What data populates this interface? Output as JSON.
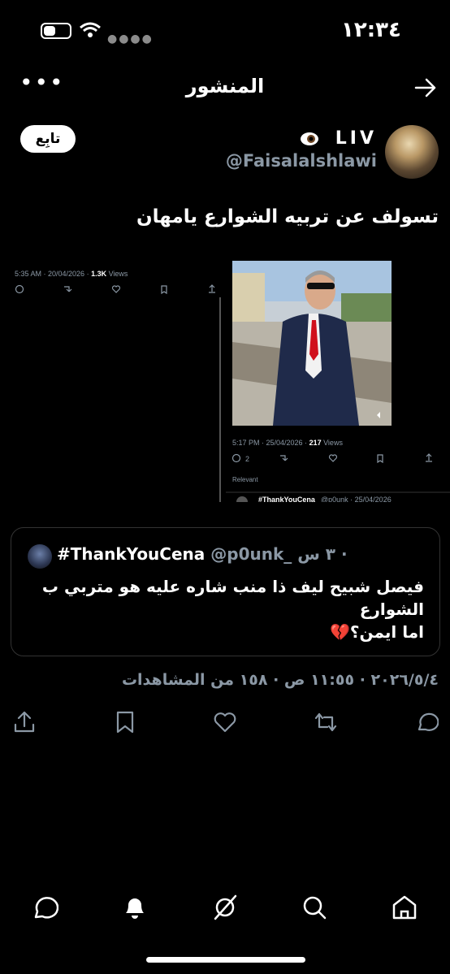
{
  "status_bar": {
    "time": "١٢:٣٤"
  },
  "header": {
    "title": "المنشور"
  },
  "author": {
    "display_name": "LIV",
    "handle": "@Faisalalshlawi",
    "follow_label": "تابِع"
  },
  "tweet": {
    "text": "تسولف عن تربيه الشوارع يامهان"
  },
  "media": {
    "left_post": {
      "timestamp": "5:35 AM · 20/04/2026 · ",
      "views_count": "1.3K",
      "views_label": " Views"
    },
    "right_post": {
      "timestamp": "5:17 PM · 25/04/2026 · ",
      "views_count": "217",
      "views_label": " Views",
      "reply_count": "2",
      "relevant_label": "Relevant",
      "next_author": "#ThankYouCena",
      "next_handle": "@p0unk · 25/04/2026"
    }
  },
  "quote": {
    "name": "#ThankYouCena",
    "handle": "@p0unk_",
    "time": "٣ س · ",
    "text_line1": "فيصل شبيح ليف ذا منب شاره عليه هو متربي ب",
    "text_line2": "الشوارع",
    "text_line3": "اما ايمن؟💔"
  },
  "meta": {
    "text": "٢٠٢٦/٥/٤ · ١١:٥٥ ص · ١٥٨ من المشاهدات"
  },
  "colors": {
    "background": "#000000",
    "secondary_text": "#8b98a5",
    "like_red": "#f91880"
  }
}
